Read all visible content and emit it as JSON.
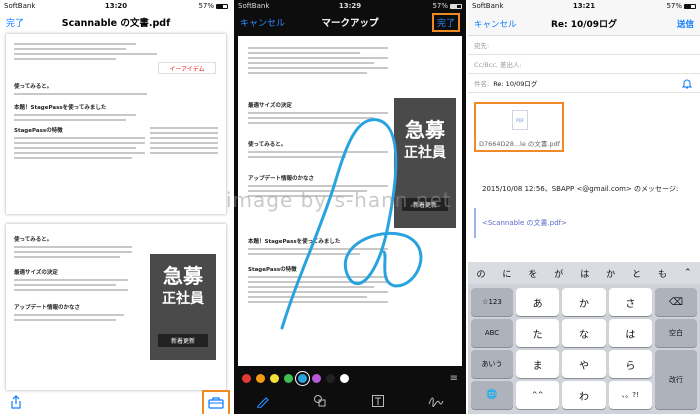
{
  "phone1": {
    "carrier": "SoftBank",
    "time": "13:20",
    "battery": "57%",
    "done_label": "完了",
    "title": "Scannable の文書.pdf",
    "doc_headings": [
      "使ってみると。",
      "本題！StagePassを使ってみました",
      "StagePassの特徴",
      "最適サイズの決定",
      "アップデート情報のかなさ"
    ],
    "ad_big": [
      "急募",
      "正社員"
    ],
    "ad_sub": "新着更新",
    "brand": "イーアイデム"
  },
  "phone2": {
    "carrier": "SoftBank",
    "time": "13:29",
    "battery": "57%",
    "cancel_label": "キャンセル",
    "title": "マークアップ",
    "done_label": "完了",
    "palette": [
      "#e53935",
      "#f39c12",
      "#f4e03a",
      "#3fbf4f",
      "#29a3e0",
      "#b65ad8",
      "#222222",
      "#ffffff"
    ],
    "selected_color_index": 4,
    "doc_headings": [
      "最適サイズの決定",
      "使ってみると。",
      "アップデート情報のかなさ",
      "本題！StagePassを使ってみました",
      "StagePassの特徴"
    ],
    "ad_big": [
      "急募",
      "正社員"
    ],
    "ad_sub": "新着更新",
    "tools": [
      "pen-tool-icon",
      "shapes-tool-icon",
      "text-tool-icon",
      "signature-tool-icon"
    ]
  },
  "phone3": {
    "carrier": "SoftBank",
    "time": "13:21",
    "battery": "57%",
    "cancel_label": "キャンセル",
    "title": "Re: 10/09ログ",
    "send_label": "送信",
    "to_label": "宛先:",
    "ccbcc_label": "Cc/Bcc, 差出人:",
    "subject_label": "件名:",
    "subject_value": "Re: 10/09ログ",
    "attachment_label": "D7664D28...le の文書.pdf",
    "file_badge": "PDF",
    "date_line": "2015/10/08 12:56、SBAPP <@gmail.com> のメッセージ:",
    "quote_text": "<Scannable の文書.pdf>",
    "candidates": [
      "の",
      "に",
      "を",
      "が",
      "は",
      "か",
      "と",
      "も"
    ],
    "keys": {
      "row1": [
        "☆123",
        "あ",
        "か",
        "さ",
        "⌫"
      ],
      "row2": [
        "ABC",
        "た",
        "な",
        "は",
        "空白"
      ],
      "row3": [
        "あいう",
        "ま",
        "や",
        "ら",
        "改行"
      ],
      "row4": [
        "🌐",
        "^^",
        "わ",
        "、。?!"
      ]
    }
  },
  "watermark": "image by s-hann.net"
}
